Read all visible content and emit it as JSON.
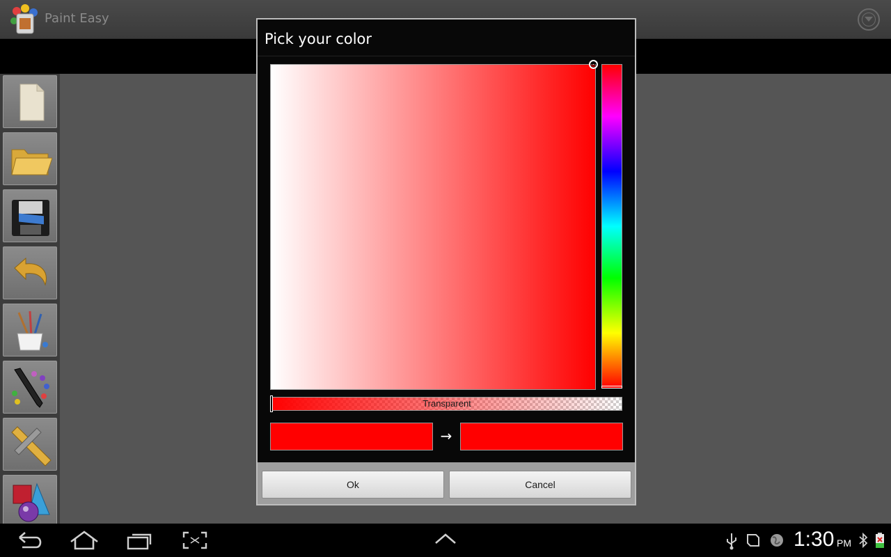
{
  "app": {
    "title": "Paint Easy"
  },
  "toolbar": {
    "tools": [
      {
        "name": "new-document"
      },
      {
        "name": "open-folder"
      },
      {
        "name": "save"
      },
      {
        "name": "undo"
      },
      {
        "name": "brushes"
      },
      {
        "name": "color-palette"
      },
      {
        "name": "measure-tools"
      },
      {
        "name": "shapes-3d"
      }
    ]
  },
  "dialog": {
    "title": "Pick your color",
    "alpha_label": "Transparent",
    "arrow": "→",
    "old_color": "#ff0000",
    "new_color": "#ff0000",
    "ok_label": "Ok",
    "cancel_label": "Cancel"
  },
  "status": {
    "time": "1:30",
    "ampm": "PM"
  },
  "colors": {
    "selected": "#ff0000",
    "dialog_bg": "#080808",
    "workspace": "#555555"
  }
}
